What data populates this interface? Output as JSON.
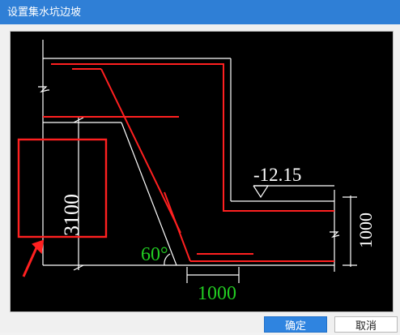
{
  "window": {
    "title": "设置集水坑边坡"
  },
  "drawing": {
    "depth_label": "3100",
    "elevation_label": "-12.15",
    "side_height_label": "1000",
    "angle_label": "60°",
    "bottom_width_label": "1000",
    "colors": {
      "background": "#000000",
      "lines": "#ffffff",
      "rebar": "#ff2020",
      "highlight": "#ff2020",
      "green_text": "#22cc22"
    }
  },
  "buttons": {
    "ok": "确定",
    "cancel": "取消"
  }
}
